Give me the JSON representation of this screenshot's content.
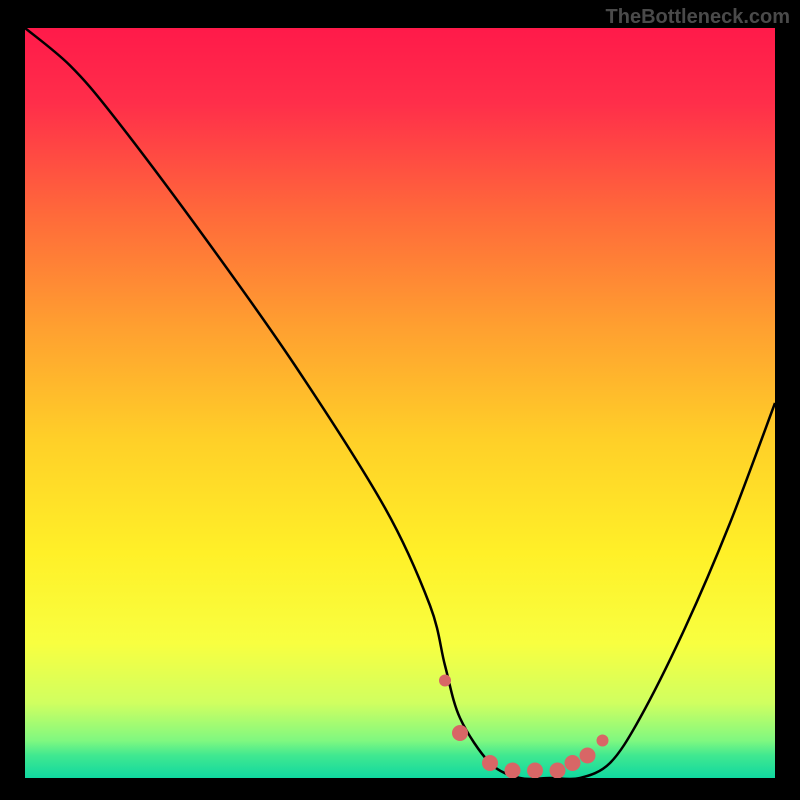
{
  "watermark": "TheBottleneck.com",
  "chart_data": {
    "type": "line",
    "title": "",
    "xlabel": "",
    "ylabel": "",
    "xlim": [
      0,
      100
    ],
    "ylim": [
      0,
      100
    ],
    "series": [
      {
        "name": "curve",
        "x": [
          0,
          6,
          12,
          24,
          36,
          48,
          54,
          56,
          58,
          62,
          66,
          70,
          74,
          78,
          82,
          88,
          94,
          100
        ],
        "y": [
          100,
          95,
          88,
          72,
          55,
          36,
          23,
          15,
          8,
          2,
          0,
          0,
          0,
          2,
          8,
          20,
          34,
          50
        ]
      }
    ],
    "background_gradient": {
      "type": "vertical",
      "stops": [
        {
          "pos": 0.0,
          "color": "#ff1a4a"
        },
        {
          "pos": 0.1,
          "color": "#ff2e4a"
        },
        {
          "pos": 0.25,
          "color": "#ff6a3a"
        },
        {
          "pos": 0.4,
          "color": "#ffa030"
        },
        {
          "pos": 0.55,
          "color": "#ffd028"
        },
        {
          "pos": 0.7,
          "color": "#fff028"
        },
        {
          "pos": 0.82,
          "color": "#f8ff40"
        },
        {
          "pos": 0.9,
          "color": "#d0ff60"
        },
        {
          "pos": 0.95,
          "color": "#80f880"
        },
        {
          "pos": 0.97,
          "color": "#40e890"
        },
        {
          "pos": 1.0,
          "color": "#10d8a0"
        }
      ]
    },
    "markers": {
      "color": "#d86666",
      "points": [
        {
          "x": 56,
          "y": 13
        },
        {
          "x": 58,
          "y": 6
        },
        {
          "x": 62,
          "y": 2
        },
        {
          "x": 65,
          "y": 1
        },
        {
          "x": 68,
          "y": 1
        },
        {
          "x": 71,
          "y": 1
        },
        {
          "x": 73,
          "y": 2
        },
        {
          "x": 75,
          "y": 3
        },
        {
          "x": 77,
          "y": 5
        }
      ]
    }
  }
}
